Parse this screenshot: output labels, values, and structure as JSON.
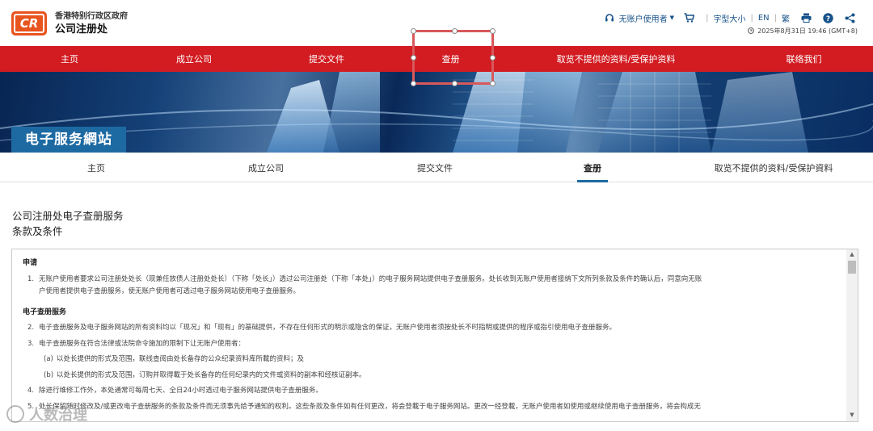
{
  "header": {
    "logo_text": "CR",
    "org_line1": "香港特别行政区政府",
    "org_line2": "公司注册处",
    "user_label": "无账户使用者",
    "font_size_label": "字型大小",
    "lang_en": "EN",
    "lang_trad": "繁",
    "datetime": "2025年8月31日 19:46 (GMT+8)"
  },
  "topnav": {
    "items": [
      {
        "label": "主页"
      },
      {
        "label": "成立公司"
      },
      {
        "label": "提交文件"
      },
      {
        "label": "查册"
      },
      {
        "label": "取览不提供的资料/受保护资料"
      },
      {
        "label": "联络我们"
      }
    ],
    "color": "#d21c22"
  },
  "banner": {
    "title": "电子服务網站"
  },
  "subnav": {
    "items": [
      {
        "label": "主页"
      },
      {
        "label": "成立公司"
      },
      {
        "label": "提交文件"
      },
      {
        "label": "查册"
      },
      {
        "label": "取览不提供的资料/受保护資料"
      }
    ],
    "active": "查册"
  },
  "page": {
    "title": "公司注册处电子查册服务",
    "subtitle": "条款及条件"
  },
  "terms": {
    "section1_heading": "申请",
    "item1_num": "1.",
    "item1_text": "无账户使用者要求公司注册处处长（现兼任放债人注册处处长）（下称「处长」）透过公司注册处（下称「本处」）的电子服务网站提供电子查册服务。处长收到无账户使用者接纳下文所列条款及条件的确认后，同意向无账",
    "item1_text2": "户使用者提供电子查册服务，使无账户使用者可透过电子服务网站使用电子查册服务。",
    "section2_heading": "电子查册服务",
    "item2_num": "2.",
    "item2_text": "电子查册服务及电子服务网站的所有资料均以「现况」和「现有」的基础提供，不存在任何形式的明示或隐含的保证，无账户使用者须按处长不时指明或提供的程序或指引使用电子查册服务。",
    "item3_num": "3.",
    "item3_text": "电子查册服务在符合法律或法院命令施加的限制下让无账户使用者：",
    "item3a_num": "(a)",
    "item3a_text": "以处长提供的形式及范围，联线查阅由处长备存的公众纪录资料库所載的资料；及",
    "item3b_num": "(b)",
    "item3b_text": "以处长提供的形式及范围，订购并取得載于处长备存的任何纪录内的文件或资料的副本和经核证副本。",
    "item4_num": "4.",
    "item4_text": "除进行维修工作外，本处通常可每周七天、全日24小时透过电子服务网站提供电子查册服务。",
    "item5_num": "5.",
    "item5_text": "处长保留随时修改及/或更改电子查册服务的条款及条件而无须事先给予通知的权利。这些条款及条件如有任何更改，将会登載于电子服务网站。更改一经登載，无账户使用者如使用或继续使用电子查册服务，将会构成无"
  },
  "watermark": {
    "text": "人数治理"
  }
}
